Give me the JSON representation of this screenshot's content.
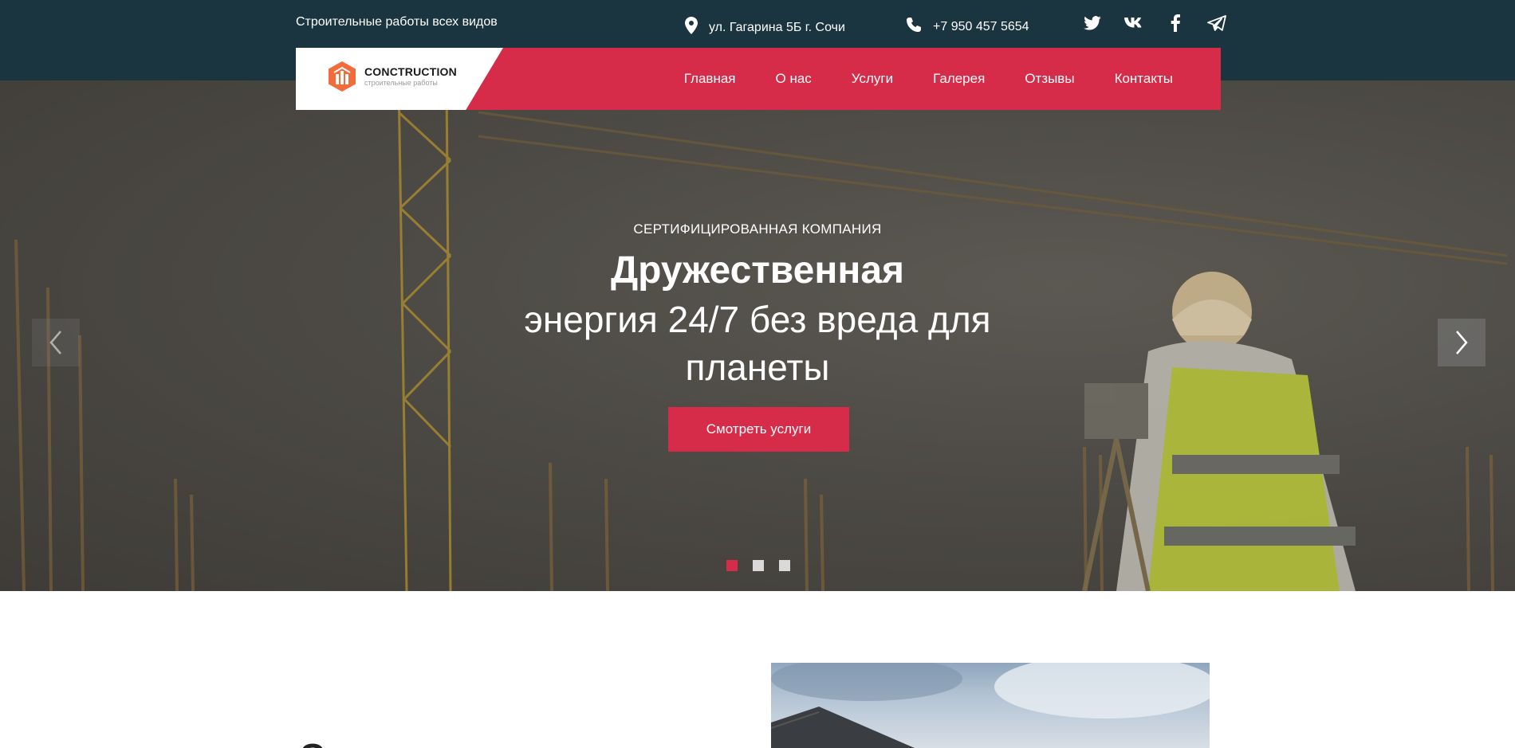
{
  "topbar": {
    "tagline": "Строительные работы всех видов",
    "address": "ул. Гагарина 5Б г. Сочи",
    "phone": "+7 950 457 5654",
    "socials": [
      "twitter-icon",
      "vk-icon",
      "facebook-icon",
      "telegram-icon"
    ]
  },
  "logo": {
    "name": "CONCTRUCTION",
    "subtitle": "строительные работы"
  },
  "nav": {
    "items": [
      "Главная",
      "О нас",
      "Услуги",
      "Галерея",
      "Отзывы",
      "Контакты"
    ]
  },
  "hero": {
    "eyebrow": "СЕРТИФИЦИРОВАННАЯ КОМПАНИЯ",
    "title": "Дружественная",
    "subtitle": "энергия 24/7 без вреда для планеты",
    "cta": "Смотреть услуги",
    "slides_total": 3,
    "active_slide": 1
  },
  "about": {
    "heading": "О компании"
  },
  "colors": {
    "accent": "#d62c4a",
    "topbar": "#1b3540",
    "logo_orange": "#f26b3a"
  }
}
